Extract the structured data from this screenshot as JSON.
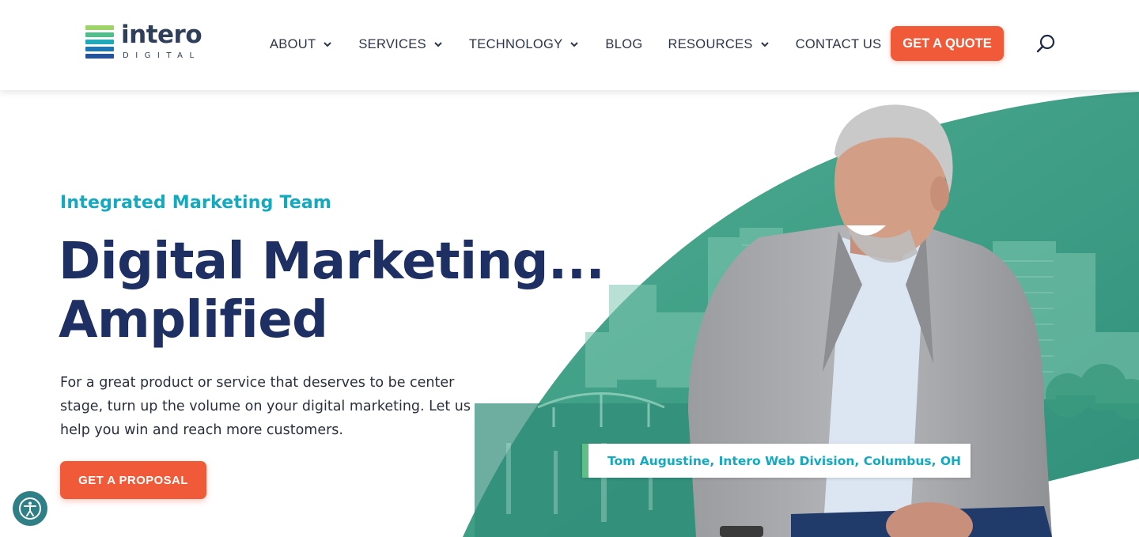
{
  "brand": {
    "name": "intero",
    "tagline": "DIGITAL",
    "bar_colors": [
      "#9ed36a",
      "#4dbf8a",
      "#1fa9b9",
      "#1b78b8",
      "#24529b"
    ]
  },
  "nav": {
    "items": [
      {
        "label": "ABOUT",
        "has_dropdown": true
      },
      {
        "label": "SERVICES",
        "has_dropdown": true
      },
      {
        "label": "TECHNOLOGY",
        "has_dropdown": true
      },
      {
        "label": "BLOG",
        "has_dropdown": false
      },
      {
        "label": "RESOURCES",
        "has_dropdown": true
      },
      {
        "label": "CONTACT US",
        "has_dropdown": false
      }
    ],
    "cta_label": "GET A QUOTE",
    "search_icon": "search-icon"
  },
  "hero": {
    "eyebrow": "Integrated Marketing Team",
    "headline_line1": "Digital Marketing...",
    "headline_line2": "Amplified",
    "description": "For a great product or service that deserves to be center stage, turn up the volume on your digital marketing. Let us help you win and reach more customers.",
    "cta_label": "GET A PROPOSAL",
    "caption": "Tom Augustine, Intero Web Division, Columbus, OH"
  },
  "accessibility": {
    "icon": "accessibility-icon"
  },
  "colors": {
    "accent_orange": "#f05a38",
    "teal": "#13a9bf",
    "navy": "#1e2f64",
    "green_bg": "#3f9e85"
  }
}
